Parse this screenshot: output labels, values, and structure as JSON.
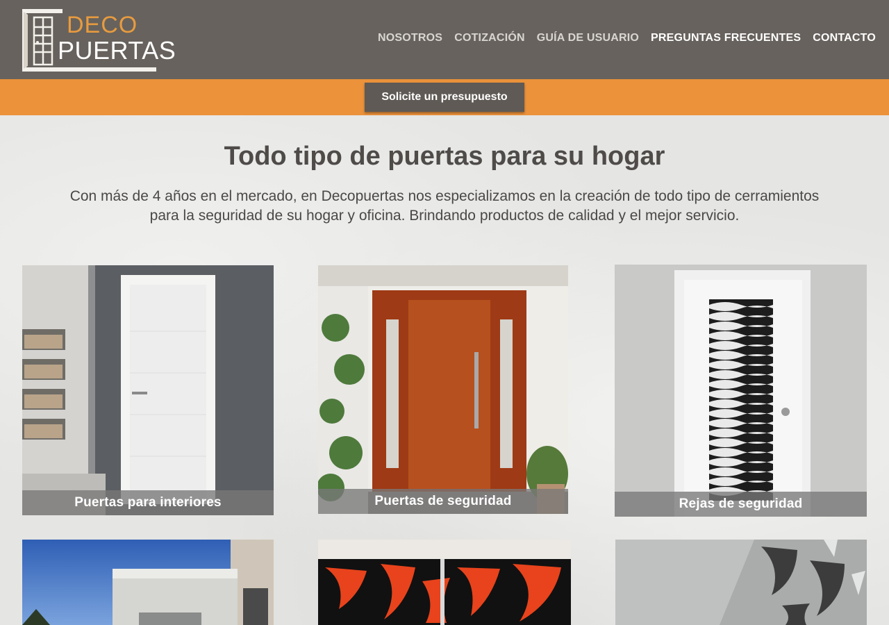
{
  "brand": {
    "line1": "DECO",
    "line2": "PUERTAS",
    "orange": "#e79b3f"
  },
  "nav": [
    {
      "label": "NOSOTROS"
    },
    {
      "label": "COTIZACIÓN"
    },
    {
      "label": "GUÍA DE USUARIO"
    },
    {
      "label": "PREGUNTAS FRECUENTES"
    },
    {
      "label": "CONTACTO"
    }
  ],
  "cta": {
    "label": "Solicite un presupuesto"
  },
  "hero": {
    "title": "Todo tipo de puertas para su hogar",
    "intro_line1": "Con más de 4 años en el mercado, en Decopuertas nos especializamos en la creación de todo tipo de cerramientos",
    "intro_line2": "para la seguridad de su hogar y oficina. Brindando productos de calidad y el mejor servicio."
  },
  "products": [
    {
      "caption": "Puertas para interiores"
    },
    {
      "caption": "Puertas de seguridad"
    },
    {
      "caption": "Rejas de seguridad"
    }
  ],
  "colors": {
    "header_bg": "#67625d",
    "orange_bar": "#eb923b",
    "cta_bg": "#5f5a55",
    "text_dark": "#4e4b49"
  }
}
